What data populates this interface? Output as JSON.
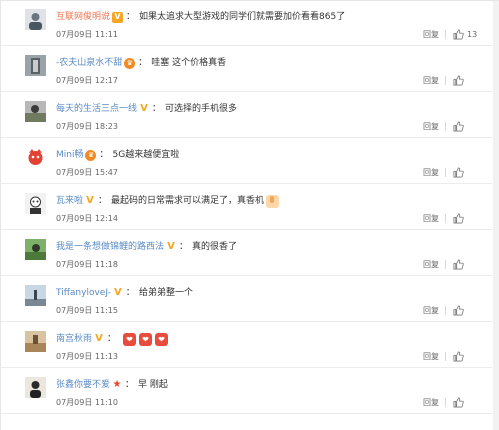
{
  "reply_label": "回复",
  "comments": [
    {
      "username": "互联网俊明说",
      "badge": "V",
      "text": "如果太追求大型游戏的同学们就需要加价看看865了",
      "time": "07月09日 11:11",
      "likes": "13"
    },
    {
      "username": "-农夫山泉水不甜",
      "badge": "crown",
      "text": "哇塞 这个价格真香",
      "time": "07月09日 12:17",
      "likes": ""
    },
    {
      "username": "每天的生活三点一线",
      "badge": "V",
      "text": "可选择的手机很多",
      "time": "07月09日 18:23",
      "likes": ""
    },
    {
      "username": "Mini畅",
      "badge": "crown",
      "text": "5G越来越便宜啦",
      "time": "07月09日 15:47",
      "likes": ""
    },
    {
      "username": "瓦来啦",
      "badge": "V",
      "text": "最起码的日常需求可以满足了，真香机",
      "time": "07月09日 12:14",
      "likes": ""
    },
    {
      "username": "我是一条想做锦鲤的路西法",
      "badge": "V",
      "text": "真的很香了",
      "time": "07月09日 11:18",
      "likes": ""
    },
    {
      "username": "TiffanyloveJ-",
      "badge": "V",
      "text": "给弟弟整一个",
      "time": "07月09日 11:15",
      "likes": ""
    },
    {
      "username": "南宫秋雨",
      "badge": "V",
      "text": "",
      "time": "07月09日 11:13",
      "likes": ""
    },
    {
      "username": "张鑫你要不爱",
      "badge": "star",
      "text": "早 刚起",
      "time": "07月09日 11:10",
      "likes": ""
    }
  ],
  "colors": {
    "username_orange": "#eb7350",
    "username_blue": "#5a8bc6",
    "text": "#333333",
    "meta": "#666666"
  },
  "icons": {
    "like": "thumbs-up-icon",
    "vip": "v-badge-icon",
    "crown": "crown-badge-icon",
    "star": "star-badge-icon"
  }
}
